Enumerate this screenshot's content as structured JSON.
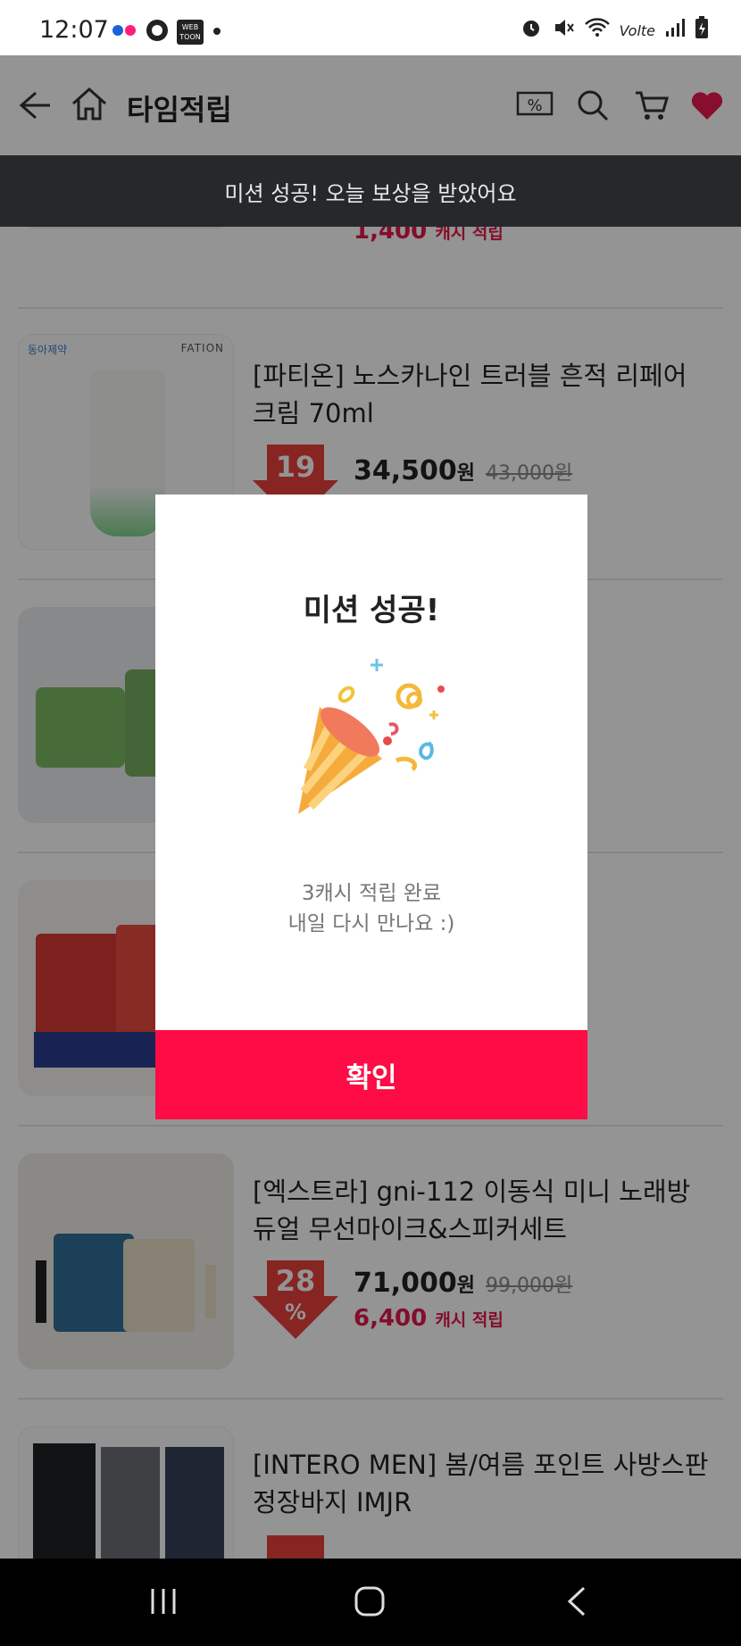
{
  "status_bar": {
    "time": "12:07",
    "app_icons": [
      "flickr-icon",
      "message-icon",
      "webtoon-icon",
      "dot-icon"
    ],
    "webtoon_text": "WEB TOON",
    "right_icons": [
      "alarm-icon",
      "mute-icon",
      "wifi-icon",
      "volte-icon",
      "signal-icon",
      "battery-icon"
    ],
    "volte_text": "Volte"
  },
  "header": {
    "title": "타임적립",
    "icons": [
      "back-arrow-icon",
      "home-icon",
      "coupon-icon",
      "search-icon",
      "cart-icon",
      "heart-icon"
    ],
    "coupon_text": "%"
  },
  "toast": {
    "text": "미션 성공! 오늘 보상을 받았어요"
  },
  "products": [
    {
      "name": "",
      "price": "",
      "original_price": "",
      "discount": "",
      "cash": "1,400",
      "cash_label": "캐시 적립"
    },
    {
      "name": "[파티온] 노스카나인 트러블 흔적 리페어 크림 70ml",
      "price": "34,500",
      "won": "원",
      "original_price": "43,000원",
      "discount": "19",
      "discount_unit": "%",
      "cash": "",
      "cash_label": "",
      "brand_tag": "동아제약",
      "brand": "FATION"
    },
    {
      "name": "",
      "price": "",
      "original_price": "",
      "discount": ""
    },
    {
      "name": "",
      "price": "",
      "original_price": "",
      "discount": ""
    },
    {
      "name": "[엑스트라] gni-112 이동식 미니 노래방 듀얼 무선마이크&스피커세트",
      "price": "71,000",
      "won": "원",
      "original_price": "99,000원",
      "discount": "28",
      "discount_unit": "%",
      "cash": "6,400",
      "cash_label": "캐시 적립"
    },
    {
      "name": "[INTERO MEN] 봄/여름 포인트 사방스판 정장바지 IMJR",
      "price": "",
      "original_price": "",
      "discount": ""
    }
  ],
  "modal": {
    "title": "미션 성공!",
    "icon": "party-popper-icon",
    "message_line1": "3캐시 적립 완료",
    "message_line2": "내일 다시 만나요 :)",
    "confirm_label": "확인"
  },
  "nav_bar": {
    "icons": [
      "recent-apps-icon",
      "home-button-icon",
      "back-button-icon"
    ]
  },
  "colors": {
    "accent": "#ff0b46",
    "cash_red": "#e3184b",
    "discount_red": "#e8413c",
    "toast_bg": "#26282c"
  }
}
